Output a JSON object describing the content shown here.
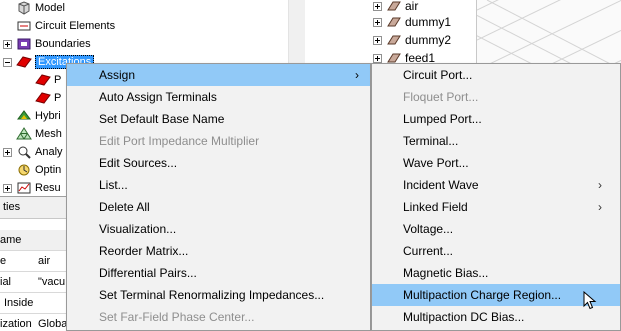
{
  "tree": {
    "items": [
      {
        "label": "Model",
        "icon": "model-icon"
      },
      {
        "label": "Circuit Elements",
        "icon": "circuit-elements-icon"
      },
      {
        "label": "Boundaries",
        "icon": "boundaries-icon"
      },
      {
        "label": "Excitations",
        "icon": "excitations-icon"
      },
      {
        "label": "P",
        "icon": "port-icon"
      },
      {
        "label": "P",
        "icon": "port-icon"
      },
      {
        "label": "Hybri",
        "icon": "hybrid-icon"
      },
      {
        "label": "Mesh",
        "icon": "mesh-icon"
      },
      {
        "label": "Analy",
        "icon": "analysis-icon"
      },
      {
        "label": "Optin",
        "icon": "optimetrics-icon"
      },
      {
        "label": "Resu",
        "icon": "results-icon"
      }
    ]
  },
  "properties": {
    "title": "ties",
    "header": {
      "name": "ame"
    },
    "rows": [
      {
        "name": "e",
        "value": "air"
      },
      {
        "name": "ial",
        "value": "\"vacu"
      },
      {
        "name": "Inside",
        "value": ""
      },
      {
        "name": "ization",
        "value": "Globa"
      }
    ]
  },
  "objects": {
    "items": [
      {
        "label": "air"
      },
      {
        "label": "dummy1"
      },
      {
        "label": "dummy2"
      },
      {
        "label": "feed1"
      }
    ]
  },
  "context_menu": {
    "items": [
      {
        "label": "Assign",
        "submenu": true,
        "disabled": false,
        "highlight": true
      },
      {
        "label": "Auto Assign Terminals",
        "submenu": false,
        "disabled": false
      },
      {
        "label": "Set Default Base Name",
        "submenu": false,
        "disabled": false
      },
      {
        "label": "Edit Port Impedance Multiplier",
        "submenu": false,
        "disabled": true
      },
      {
        "label": "Edit Sources...",
        "submenu": false,
        "disabled": false
      },
      {
        "label": "List...",
        "submenu": false,
        "disabled": false
      },
      {
        "label": "Delete All",
        "submenu": false,
        "disabled": false
      },
      {
        "label": "Visualization...",
        "submenu": false,
        "disabled": false
      },
      {
        "label": "Reorder Matrix...",
        "submenu": false,
        "disabled": false
      },
      {
        "label": "Differential Pairs...",
        "submenu": false,
        "disabled": false
      },
      {
        "label": "Set Terminal Renormalizing Impedances...",
        "submenu": false,
        "disabled": false
      },
      {
        "label": "Set Far-Field Phase Center...",
        "submenu": false,
        "disabled": true
      }
    ]
  },
  "submenu": {
    "items": [
      {
        "label": "Circuit Port...",
        "submenu": false,
        "disabled": false
      },
      {
        "label": "Floquet Port...",
        "submenu": false,
        "disabled": true
      },
      {
        "label": "Lumped Port...",
        "submenu": false,
        "disabled": false
      },
      {
        "label": "Terminal...",
        "submenu": false,
        "disabled": false
      },
      {
        "label": "Wave Port...",
        "submenu": false,
        "disabled": false
      },
      {
        "label": "Incident Wave",
        "submenu": true,
        "disabled": false
      },
      {
        "label": "Linked Field",
        "submenu": true,
        "disabled": false
      },
      {
        "label": "Voltage...",
        "submenu": false,
        "disabled": false
      },
      {
        "label": "Current...",
        "submenu": false,
        "disabled": false
      },
      {
        "label": "Magnetic Bias...",
        "submenu": false,
        "disabled": false
      },
      {
        "label": "Multipaction Charge Region...",
        "submenu": false,
        "disabled": false,
        "highlight": true
      },
      {
        "label": "Multipaction DC Bias...",
        "submenu": false,
        "disabled": false
      }
    ]
  },
  "glyphs": {
    "submenu_arrow": "›"
  },
  "colors": {
    "menu_bg": "#f2f2f2",
    "menu_highlight": "#91c9f7",
    "tree_selection": "#3399ff",
    "disabled_text": "#8e8e8e",
    "view_accent": "#e8008e"
  }
}
